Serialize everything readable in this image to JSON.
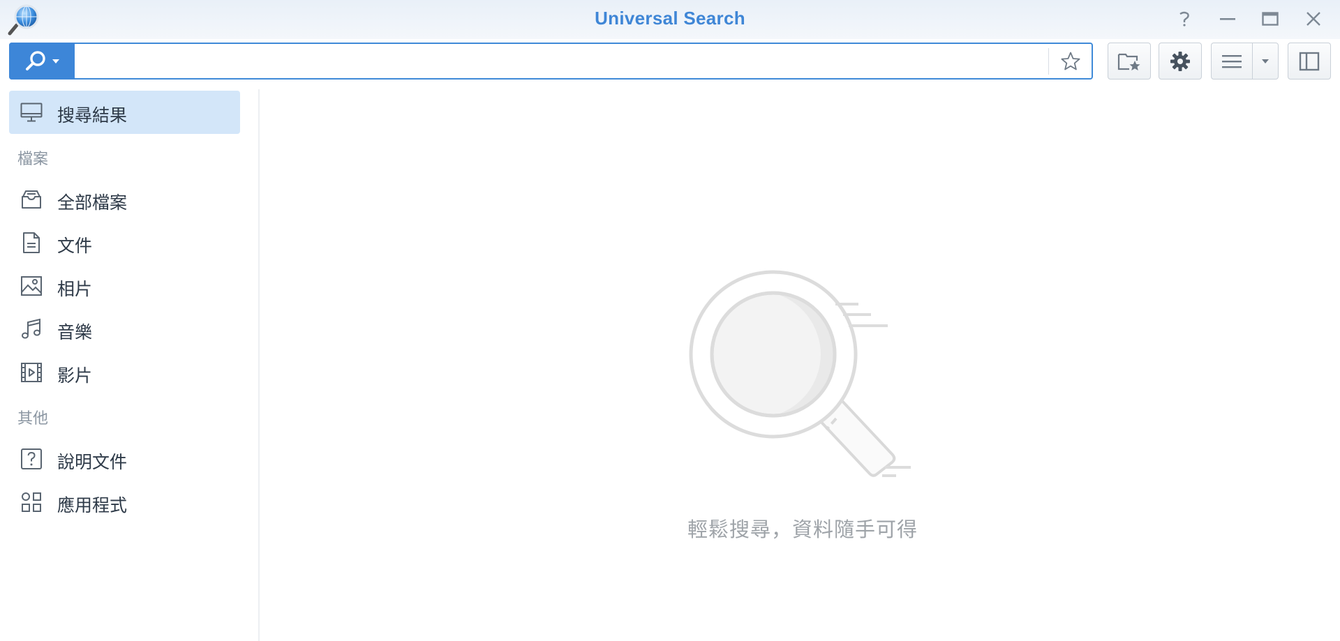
{
  "window": {
    "title": "Universal Search"
  },
  "toolbar": {
    "search_value": "",
    "search_placeholder": ""
  },
  "sidebar": {
    "top_item": {
      "label": "搜尋結果",
      "icon": "monitor-icon"
    },
    "sections": [
      {
        "heading": "檔案",
        "items": [
          {
            "label": "全部檔案",
            "icon": "inbox-icon"
          },
          {
            "label": "文件",
            "icon": "document-icon"
          },
          {
            "label": "相片",
            "icon": "image-icon"
          },
          {
            "label": "音樂",
            "icon": "music-note-icon"
          },
          {
            "label": "影片",
            "icon": "film-icon"
          }
        ]
      },
      {
        "heading": "其他",
        "items": [
          {
            "label": "說明文件",
            "icon": "help-icon"
          },
          {
            "label": "應用程式",
            "icon": "apps-grid-icon"
          }
        ]
      }
    ]
  },
  "main": {
    "empty_message": "輕鬆搜尋，資料隨手可得"
  },
  "colors": {
    "accent": "#3d86d8",
    "title": "#3f86d6",
    "active_bg": "#d3e6f9"
  }
}
